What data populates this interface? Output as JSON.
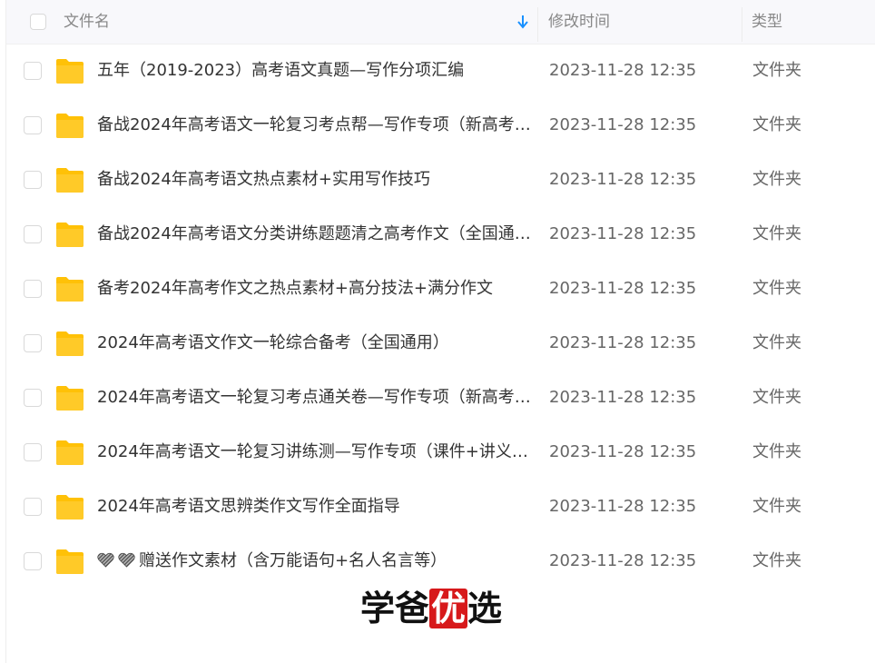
{
  "header": {
    "col_name": "文件名",
    "col_time": "修改时间",
    "col_type": "类型",
    "sort_icon": "sort-down-arrow-icon",
    "accent": "#1890ff"
  },
  "folder_color": "#ffc107",
  "rows": [
    {
      "name": "五年（2019-2023）高考语文真题—写作分项汇编",
      "time": "2023-11-28 12:35",
      "type": "文件夹"
    },
    {
      "name": "备战2024年高考语文一轮复习考点帮—写作专项（新高考…",
      "time": "2023-11-28 12:35",
      "type": "文件夹"
    },
    {
      "name": "备战2024年高考语文热点素材+实用写作技巧",
      "time": "2023-11-28 12:35",
      "type": "文件夹"
    },
    {
      "name": "备战2024年高考语文分类讲练题题清之高考作文（全国通…",
      "time": "2023-11-28 12:35",
      "type": "文件夹"
    },
    {
      "name": "备考2024年高考作文之热点素材+高分技法+满分作文",
      "time": "2023-11-28 12:35",
      "type": "文件夹"
    },
    {
      "name": "2024年高考语文作文一轮综合备考（全国通用）",
      "time": "2023-11-28 12:35",
      "type": "文件夹"
    },
    {
      "name": "2024年高考语文一轮复习考点通关卷—写作专项（新高考…",
      "time": "2023-11-28 12:35",
      "type": "文件夹"
    },
    {
      "name": "2024年高考语文一轮复习讲练测—写作专项（课件+讲义…",
      "time": "2023-11-28 12:35",
      "type": "文件夹"
    },
    {
      "name": "2024年高考语文思辨类作文写作全面指导",
      "time": "2023-11-28 12:35",
      "type": "文件夹"
    },
    {
      "name": "赠送作文素材（含万能语句+名人名言等）",
      "time": "2023-11-28 12:35",
      "type": "文件夹",
      "prefix_icons": [
        "heart-icon",
        "heart-icon"
      ]
    }
  ],
  "watermark": {
    "part1": "学爸",
    "seal": "优",
    "part2": "选",
    "seal_color": "#d7191b"
  }
}
